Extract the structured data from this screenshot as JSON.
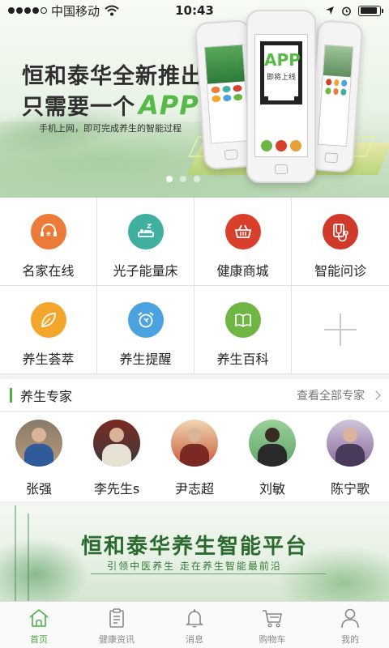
{
  "status_bar": {
    "carrier": "中国移动",
    "time": "10:43"
  },
  "banner": {
    "headline_line1": "恒和泰华全新推出",
    "headline_line2_prefix": "只需要一个",
    "headline_app": "APP",
    "subtitle": "手机上网，即可完成养生的智能过程",
    "qr_app": "APP",
    "qr_caption": "即将上线",
    "active_page": 0
  },
  "services": [
    {
      "label": "名家在线",
      "icon": "headset-icon",
      "color": "#ec7b3a"
    },
    {
      "label": "光子能量床",
      "icon": "bed-icon",
      "color": "#3fb0a0"
    },
    {
      "label": "健康商城",
      "icon": "basket-icon",
      "color": "#d9402b"
    },
    {
      "label": "智能问诊",
      "icon": "stethoscope-icon",
      "color": "#cf3a2a"
    },
    {
      "label": "养生荟萃",
      "icon": "leaf-icon",
      "color": "#f2a62c"
    },
    {
      "label": "养生提醒",
      "icon": "alarm-clock-icon",
      "color": "#4aa3df"
    },
    {
      "label": "养生百科",
      "icon": "book-icon",
      "color": "#6fb544"
    }
  ],
  "experts_section": {
    "title": "养生专家",
    "more_label": "查看全部专家",
    "items": [
      {
        "name": "张强"
      },
      {
        "name": "李先生s"
      },
      {
        "name": "尹志超"
      },
      {
        "name": "刘敏"
      },
      {
        "name": "陈宁歌"
      }
    ]
  },
  "promo_banner": {
    "title": "恒和泰华养生智能平台",
    "subtitle": "引领中医养生 走在养生智能最前沿"
  },
  "tabbar": {
    "items": [
      {
        "label": "首页",
        "icon": "home-icon",
        "active": true
      },
      {
        "label": "健康资讯",
        "icon": "clipboard-icon",
        "active": false
      },
      {
        "label": "消息",
        "icon": "bell-icon",
        "active": false
      },
      {
        "label": "购物车",
        "icon": "cart-icon",
        "active": false
      },
      {
        "label": "我的",
        "icon": "user-icon",
        "active": false
      }
    ],
    "active_color": "#4cae4c",
    "inactive_color": "#888888"
  }
}
